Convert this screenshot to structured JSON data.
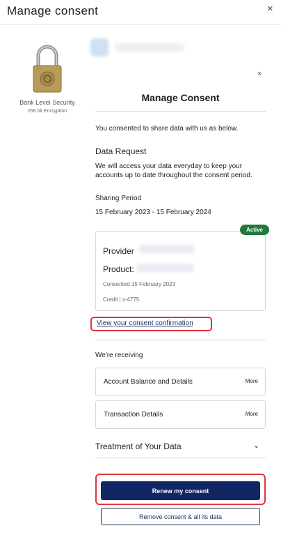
{
  "header": {
    "title": "Manage consent",
    "close_glyph": "×"
  },
  "security": {
    "icon": "padlock-icon",
    "label": "Bank Level Security",
    "sub": "256 bit Encryption"
  },
  "panel": {
    "close_glyph": "×",
    "title": "Manage Consent",
    "intro": "You consented to share data with us as below.",
    "data_request": {
      "heading": "Data Request",
      "text": "We will access your data everyday to keep your accounts up to date throughout the consent period."
    },
    "sharing_period": {
      "heading": "Sharing Period",
      "value": "15 February 2023 - 15 February 2024"
    },
    "consent_card": {
      "status": "Active",
      "status_color": "#1f7a3a",
      "provider_label": "Provider",
      "product_label": "Product:",
      "consented": "Consented 15 February 2023",
      "account": "Credit | x-4775"
    },
    "confirmation_link": "View your consent confirmation",
    "receiving": {
      "heading": "We're receiving",
      "items": [
        {
          "label": "Account Balance and Details",
          "more": "More"
        },
        {
          "label": "Transaction Details",
          "more": "More"
        }
      ]
    },
    "treatment": {
      "label": "Treatment of Your Data",
      "icon": "chevron-down-icon"
    },
    "buttons": {
      "renew": "Renew my consent",
      "remove": "Remove consent & all its data"
    }
  },
  "colors": {
    "primary": "#112663",
    "highlight": "#e0363b",
    "success": "#1f7a3a"
  }
}
